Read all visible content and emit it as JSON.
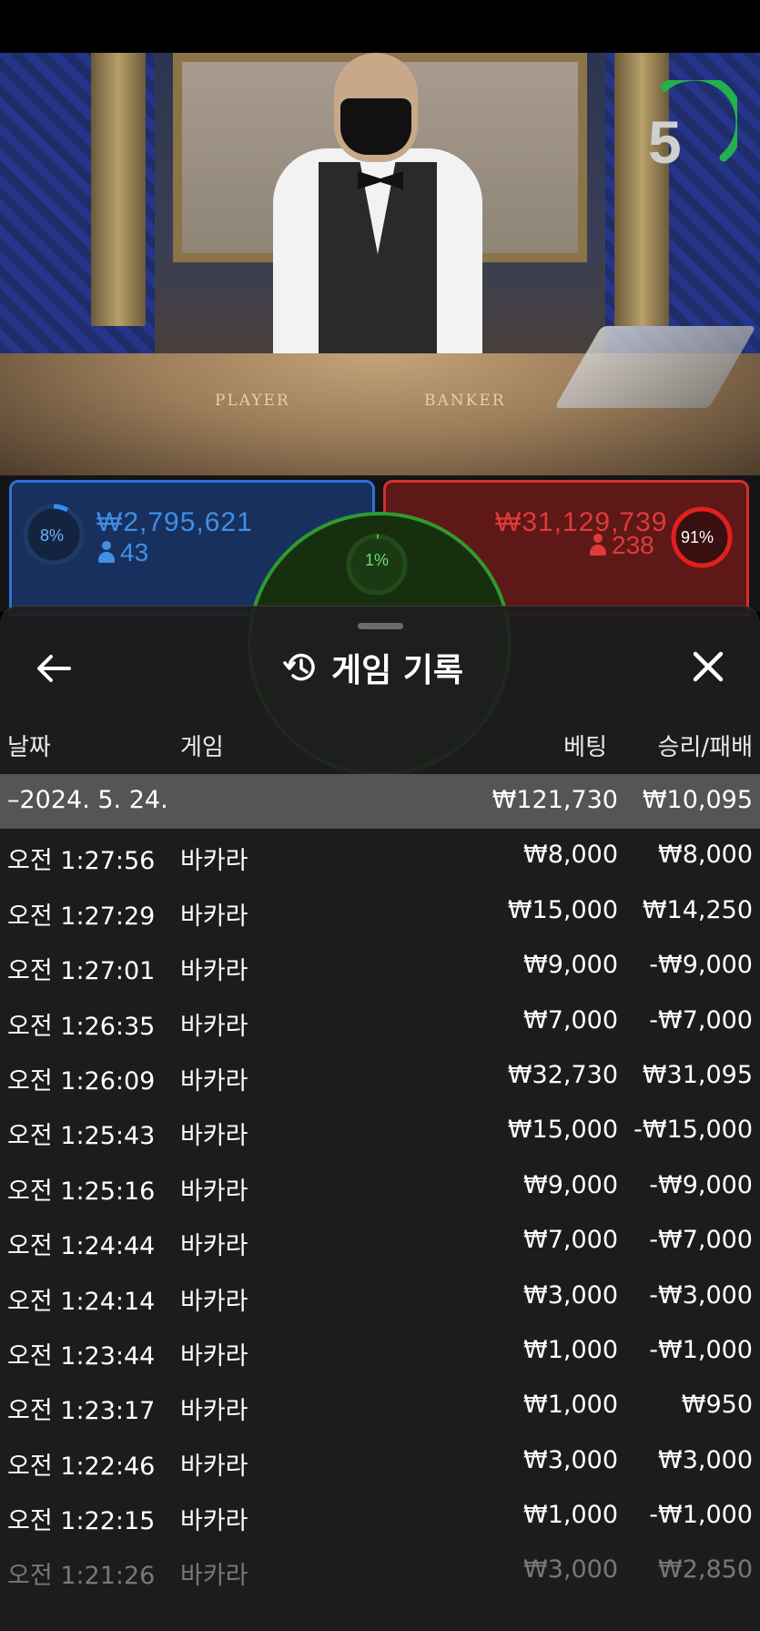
{
  "video": {
    "timer": "5",
    "table_player": "PLAYER",
    "table_banker": "BANKER"
  },
  "bets": {
    "player": {
      "percent": "8%",
      "amount": "₩2,795,621",
      "count": "43"
    },
    "tie": {
      "percent": "1%"
    },
    "banker": {
      "percent": "91%",
      "amount": "₩31,129,739",
      "count": "238"
    }
  },
  "colors": {
    "player_blue": "#2f6fd6",
    "banker_red": "#d62f2f",
    "tie_green": "#2f9a2f",
    "timer_green": "#22b14c"
  },
  "header": {
    "back_icon": "arrow-left-icon",
    "history_icon": "history-icon",
    "title": "게임 기록",
    "close_icon": "close-icon"
  },
  "columns": {
    "date": "날짜",
    "game": "게임",
    "bet": "베팅",
    "result": "승리/패배"
  },
  "summary": {
    "date": "–2024. 5. 24.",
    "bet": "₩121,730",
    "result": "₩10,095"
  },
  "rows": [
    {
      "time": "오전 1:27:56",
      "game": "바카라",
      "bet": "₩8,000",
      "result": "₩8,000"
    },
    {
      "time": "오전 1:27:29",
      "game": "바카라",
      "bet": "₩15,000",
      "result": "₩14,250"
    },
    {
      "time": "오전 1:27:01",
      "game": "바카라",
      "bet": "₩9,000",
      "result": "-₩9,000"
    },
    {
      "time": "오전 1:26:35",
      "game": "바카라",
      "bet": "₩7,000",
      "result": "-₩7,000"
    },
    {
      "time": "오전 1:26:09",
      "game": "바카라",
      "bet": "₩32,730",
      "result": "₩31,095"
    },
    {
      "time": "오전 1:25:43",
      "game": "바카라",
      "bet": "₩15,000",
      "result": "-₩15,000"
    },
    {
      "time": "오전 1:25:16",
      "game": "바카라",
      "bet": "₩9,000",
      "result": "-₩9,000"
    },
    {
      "time": "오전 1:24:44",
      "game": "바카라",
      "bet": "₩7,000",
      "result": "-₩7,000"
    },
    {
      "time": "오전 1:24:14",
      "game": "바카라",
      "bet": "₩3,000",
      "result": "-₩3,000"
    },
    {
      "time": "오전 1:23:44",
      "game": "바카라",
      "bet": "₩1,000",
      "result": "-₩1,000"
    },
    {
      "time": "오전 1:23:17",
      "game": "바카라",
      "bet": "₩1,000",
      "result": "₩950"
    },
    {
      "time": "오전 1:22:46",
      "game": "바카라",
      "bet": "₩3,000",
      "result": "₩3,000"
    },
    {
      "time": "오전 1:22:15",
      "game": "바카라",
      "bet": "₩1,000",
      "result": "-₩1,000"
    },
    {
      "time": "오전 1:21:26",
      "game": "바카라",
      "bet": "₩3,000",
      "result": "₩2,850"
    }
  ]
}
